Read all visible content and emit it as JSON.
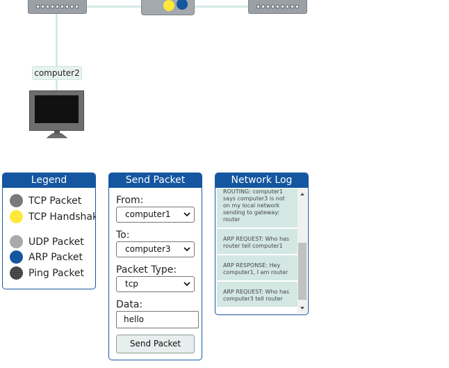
{
  "topology": {
    "node_label": "computer2",
    "packet_colors": {
      "handshake": "#ffe83a",
      "arp": "#1456a0"
    }
  },
  "legend": {
    "title": "Legend",
    "items": [
      {
        "label": "TCP Packet",
        "color": "#7a7a7a"
      },
      {
        "label": "TCP Handshake",
        "color": "#ffe83a"
      },
      {
        "label": "UDP Packet",
        "color": "#a9a9a9"
      },
      {
        "label": "ARP Packet",
        "color": "#1456a0"
      },
      {
        "label": "Ping Packet",
        "color": "#333333",
        "pattern": "dotted"
      }
    ]
  },
  "send": {
    "title": "Send Packet",
    "from_label": "From:",
    "from_value": "computer1",
    "to_label": "To:",
    "to_value": "computer3",
    "type_label": "Packet Type:",
    "type_value": "tcp",
    "data_label": "Data:",
    "data_value": "hello",
    "button": "Send Packet"
  },
  "log": {
    "title": "Network Log",
    "entries": [
      "ROUTING: computer1 says computer3 is not on my local network sending to gateway: router",
      "ARP REQUEST: Who has router tell computer1",
      "ARP RESPONSE: Hey computer1, I am router",
      "ARP REQUEST: Who has computer3 tell router"
    ]
  }
}
